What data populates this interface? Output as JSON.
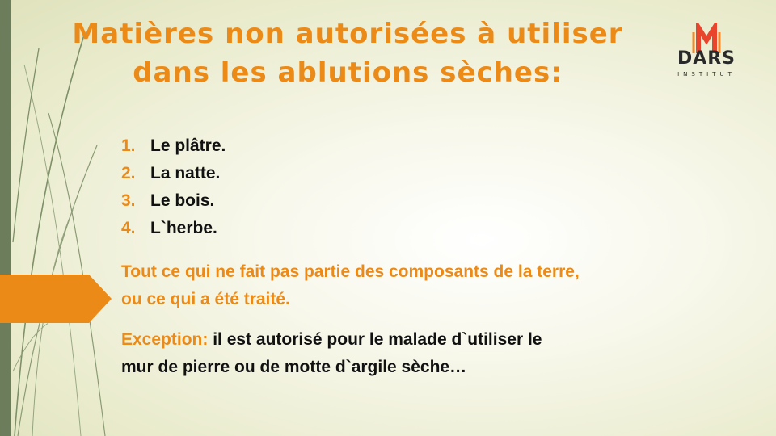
{
  "title": {
    "line1": "Matières non autorisées à utiliser",
    "line2": "dans les ablutions sèches:"
  },
  "logo": {
    "word": "DARS",
    "sub": "INSTITUT",
    "accent_color": "#e8452c"
  },
  "list": [
    {
      "num": "1.",
      "text": "Le plâtre."
    },
    {
      "num": "2.",
      "text": "La natte."
    },
    {
      "num": "3.",
      "text": "Le bois."
    },
    {
      "num": "4.",
      "text": "L`herbe."
    }
  ],
  "note": {
    "line1": "Tout ce qui ne fait pas partie des composants de la terre,",
    "line2": "ou ce qui a été traité."
  },
  "exception": {
    "label": "Exception:",
    "text1": " il est autorisé pour le malade d`utiliser le",
    "text2": "mur de pierre ou de motte d`argile sèche…"
  },
  "colors": {
    "accent": "#ec8a17",
    "sidebar": "#6b7d5a",
    "text": "#111111"
  }
}
